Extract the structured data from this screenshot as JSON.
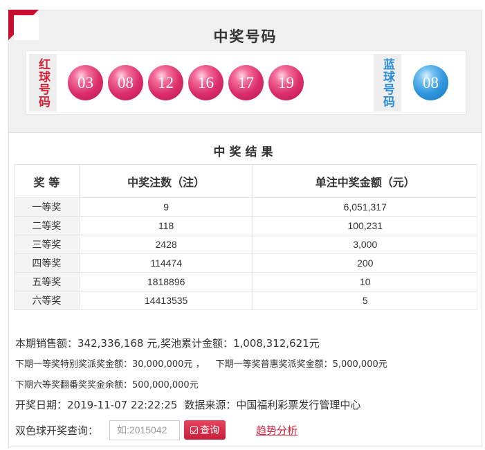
{
  "win_numbers": {
    "title": "中奖号码",
    "red_label": "红球号码",
    "blue_label": "蓝球号码",
    "red_balls": [
      "03",
      "08",
      "12",
      "16",
      "17",
      "19"
    ],
    "blue_ball": "08"
  },
  "results": {
    "title": "中奖结果",
    "headers": [
      "奖 等",
      "中奖注数（注）",
      "单注中奖金额（元）"
    ],
    "rows": [
      {
        "level": "一等奖",
        "count": "9",
        "amount": "6,051,317"
      },
      {
        "level": "二等奖",
        "count": "118",
        "amount": "100,231"
      },
      {
        "level": "三等奖",
        "count": "2428",
        "amount": "3,000"
      },
      {
        "level": "四等奖",
        "count": "114474",
        "amount": "200"
      },
      {
        "level": "五等奖",
        "count": "1818896",
        "amount": "10"
      },
      {
        "level": "六等奖",
        "count": "14413535",
        "amount": "5"
      }
    ]
  },
  "info": {
    "sales_line": "本期销售额：342,336,168 元,奖池累计金额：1,008,312,621元",
    "next_first_special": "下期一等奖特别奖派奖金额：30,000,000元 ，",
    "next_first_common": "下期一等奖普惠奖派奖金额：5,000,000元",
    "next_sixth": "下期六等奖翻番奖奖金余额：500,000,000元",
    "draw_date": "开奖日期：2019-11-07 22:22:25",
    "source": "数据来源：中国福利彩票发行管理中心"
  },
  "query": {
    "label": "双色球开奖查询：",
    "placeholder": "如:2015042",
    "button": "查询",
    "trend_link": "趋势分析"
  },
  "colors": {
    "brand_red": "#c8102e",
    "red_ball": "#dc2f6c",
    "blue_ball": "#2f96dd"
  }
}
